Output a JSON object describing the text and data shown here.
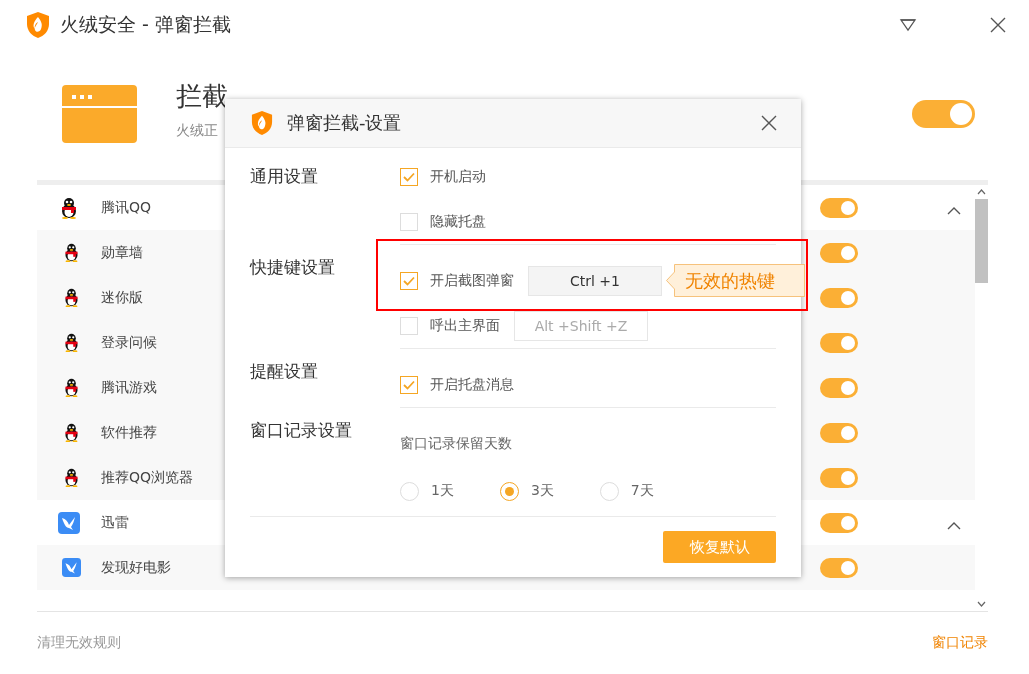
{
  "window": {
    "title": "火绒安全 - 弹窗拦截"
  },
  "header": {
    "title": "拦截",
    "subtitle": "火绒正",
    "on": true
  },
  "groups": [
    {
      "name": "腾讯QQ",
      "kind": "qq",
      "on": true,
      "expanded": true,
      "children": [
        {
          "name": "勋章墙",
          "on": true
        },
        {
          "name": "迷你版",
          "on": true
        },
        {
          "name": "登录问候",
          "on": true
        },
        {
          "name": "腾讯游戏",
          "on": true
        },
        {
          "name": "软件推荐",
          "on": true
        },
        {
          "name": "推荐QQ浏览器",
          "on": true
        }
      ]
    },
    {
      "name": "迅雷",
      "kind": "xunlei",
      "on": true,
      "expanded": true,
      "children": [
        {
          "name": "发现好电影",
          "on": true
        }
      ]
    }
  ],
  "footer": {
    "clean_link": "清理无效规则",
    "history_link": "窗口记录"
  },
  "dialog": {
    "title": "弹窗拦截-设置",
    "sections": [
      {
        "label": "通用设置",
        "rows": [
          {
            "kind": "checkbox",
            "label": "开机启动",
            "checked": true
          },
          {
            "kind": "checkbox",
            "label": "隐藏托盘",
            "checked": false
          }
        ]
      },
      {
        "label": "快捷键设置",
        "rows": [
          {
            "kind": "hotkey",
            "label": "开启截图弹窗",
            "checked": true,
            "hotkey": "Ctrl +1",
            "error": "无效的热键",
            "highlighted": true
          },
          {
            "kind": "hotkey",
            "label": "呼出主界面",
            "checked": false,
            "hotkey": "Alt +Shift +Z"
          }
        ]
      },
      {
        "label": "提醒设置",
        "rows": [
          {
            "kind": "checkbox",
            "label": "开启托盘消息",
            "checked": true
          }
        ]
      },
      {
        "label": "窗口记录设置",
        "rows": [
          {
            "kind": "note",
            "label": "窗口记录保留天数"
          },
          {
            "kind": "radios",
            "options": [
              {
                "label": "1天",
                "selected": false
              },
              {
                "label": "3天",
                "selected": true
              },
              {
                "label": "7天",
                "selected": false
              }
            ]
          }
        ]
      }
    ],
    "button": "恢复默认"
  }
}
